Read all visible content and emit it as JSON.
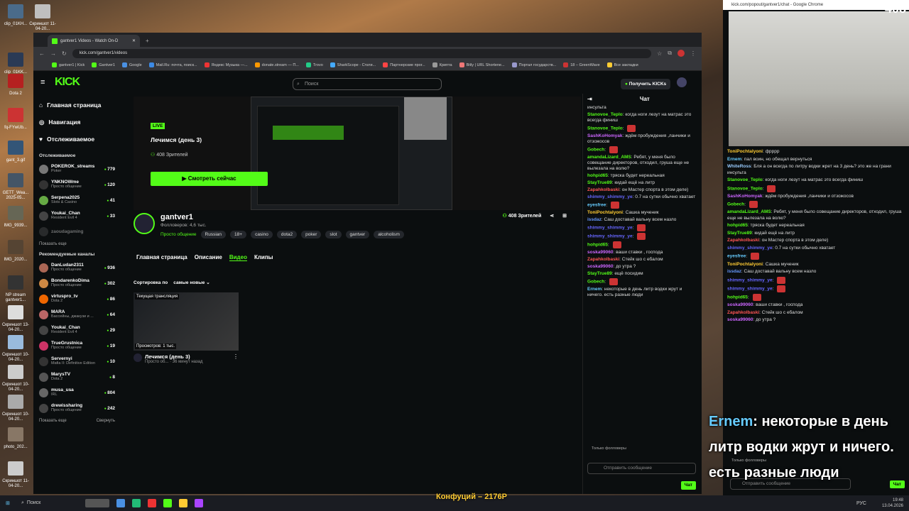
{
  "desktop": {
    "icons": [
      {
        "label": "clip_01KH...",
        "color": "#4a6b8a"
      },
      {
        "label": "Скриншот 11-04-20...",
        "color": "#bfbfbf"
      },
      {
        "label": "clip_01KK...",
        "color": "#2a3a55"
      },
      {
        "label": "Dota 2",
        "color": "#b52020"
      },
      {
        "label": "fq-FYwUb...",
        "color": "#c33"
      },
      {
        "label": "gant_3.gif",
        "color": "#357"
      },
      {
        "label": "GETT_Wea... 2025-05...",
        "color": "#456"
      },
      {
        "label": "IMG_9939...",
        "color": "#665"
      },
      {
        "label": "IMG_2020...",
        "color": "#543"
      },
      {
        "label": "NP stream gantver1...",
        "color": "#333"
      },
      {
        "label": "Скриншот 13-04-20...",
        "color": "#ddd"
      },
      {
        "label": "Скриншот 10-04-20...",
        "color": "#9bd"
      },
      {
        "label": "Скриншот 10-04-20...",
        "color": "#ccc"
      },
      {
        "label": "Скриншот 10-04-20...",
        "color": "#aaa"
      },
      {
        "label": "photo_202...",
        "color": "#876"
      },
      {
        "label": "Скриншот 11-04-20...",
        "color": "#ccc"
      }
    ]
  },
  "browser": {
    "tab_title": "gantver1 Videos - Watch On-D",
    "url": "kick.com/gantver1/videos",
    "bookmarks": [
      "gantver1 | Kick",
      "Gantver1",
      "Google",
      "Mail.Ru: почта, поиск...",
      "Яндекс Музыка —...",
      "donate.stream — П...",
      "Trovo",
      "SharkScope - Стати...",
      "Партнерские прог...",
      "Криптa",
      "Bitly | URL Shortene...",
      "Портал государств...",
      "18 – GreenWave",
      "Все закладки"
    ]
  },
  "kick": {
    "logo": "KICK",
    "search_placeholder": "Поиск",
    "get_kicks": "Получить KICKs",
    "nav": [
      {
        "label": "Главная страница",
        "icon": "home-icon"
      },
      {
        "label": "Навигация",
        "icon": "compass-icon"
      },
      {
        "label": "Отслеживаемое",
        "icon": "heart-icon"
      }
    ],
    "following_title": "Отслеживаемое",
    "following": [
      {
        "name": "POKEROK_streams",
        "cat": "Poker",
        "viewers": "779",
        "color": "#777"
      },
      {
        "name": "YNKNOWme",
        "cat": "Просто общение",
        "viewers": "120",
        "color": "#333"
      },
      {
        "name": "Serpena2025",
        "cat": "Slots & Casino",
        "viewers": "41",
        "color": "#6a4"
      },
      {
        "name": "Youkai_Chan",
        "cat": "Resident Evil 4",
        "viewers": "33",
        "color": "#444"
      },
      {
        "name": "zaoudagaming",
        "cat": "",
        "viewers": "",
        "color": "#555"
      }
    ],
    "show_more": "Показать еще",
    "recommended_title": "Рекомендуемые каналы",
    "recommended": [
      {
        "name": "DanLudan2311",
        "cat": "Просто общение",
        "viewers": "936",
        "color": "#a65"
      },
      {
        "name": "BondarenkoDima",
        "cat": "Просто общение",
        "viewers": "302",
        "color": "#c84"
      },
      {
        "name": "virtuspro_tv",
        "cat": "Dota 2",
        "viewers": "86",
        "color": "#e60"
      },
      {
        "name": "MARA",
        "cat": "Бассейны, джакузи и ...",
        "viewers": "64",
        "color": "#b66"
      },
      {
        "name": "Youkai_Chan",
        "cat": "Resident Evil 4",
        "viewers": "29",
        "color": "#444"
      },
      {
        "name": "TrueGrustnica",
        "cat": "Просто общение",
        "viewers": "19",
        "color": "#c36"
      },
      {
        "name": "Servernyi",
        "cat": "Mafia II: Definitive Edition",
        "viewers": "10",
        "color": "#333"
      },
      {
        "name": "MarysTV",
        "cat": "Dota 2",
        "viewers": "8",
        "color": "#555"
      },
      {
        "name": "musa_usa",
        "cat": "IRL",
        "viewers": "804",
        "color": "#666"
      },
      {
        "name": "drewissharing",
        "cat": "Просто общение",
        "viewers": "242",
        "color": "#444"
      }
    ],
    "show_more2": "Показать еще",
    "collapse": "Свернуть",
    "live_label": "LIVE",
    "stream_title": "Лечимся (день 3)",
    "live_viewers": "408 Зрителей",
    "watch_now": "Смотреть сейчас",
    "channel": {
      "name": "gantver1",
      "followers": "Фолловеров: 4,6 тыс.",
      "category": "Просто общение",
      "tags": [
        "Russian",
        "18+",
        "casino",
        "dota2",
        "poker",
        "slot",
        "gantver",
        "alcoholism"
      ],
      "viewers": "408 Зрителей"
    },
    "subnav": [
      "Главная страница",
      "Описание",
      "Видео",
      "Клипы"
    ],
    "sort_label": "Сортировка по",
    "sort_value": "самые новые",
    "video": {
      "badge": "Текущая трансляция",
      "views": "Просмотров: 1 тыс.",
      "title": "Лечимся (день 3)",
      "meta": "Просто об... · 36 минут назад"
    }
  },
  "chat": {
    "title": "Чат",
    "messages": [
      {
        "user": "",
        "text": "инсульта",
        "color": "#ddd"
      },
      {
        "user": "Stanovoe_Teplo",
        "text": "когда ноги лезут на матрас это всегда финиш",
        "color": "#53fc18"
      },
      {
        "user": "Stanovoe_Teplo",
        "text": "",
        "color": "#53fc18"
      },
      {
        "user": "SashKoHomyak",
        "text": "ждём пробуждения ,ланчики и отзожосов",
        "color": "#c6f"
      },
      {
        "user": "Gobech",
        "text": "",
        "color": "#53fc18"
      },
      {
        "user": "amandaLizard_AMS",
        "text": "Ребят, у меня было совещание директоров, отходил, груша еще не вылезала на волю?",
        "color": "#53fc18"
      },
      {
        "user": "hohpid65",
        "text": "тряска будет нереальная",
        "color": "#53fc18"
      },
      {
        "user": "StayTrue89",
        "text": "кидай ещё на литр",
        "color": "#53fc18"
      },
      {
        "user": "Zapahkolbaski",
        "text": "он Мастер спорта в этом деле)",
        "color": "#f55"
      },
      {
        "user": "shimmy_shimmy_ye",
        "text": "0.7 на сутки обычно хватает",
        "color": "#66f"
      },
      {
        "user": "eyesfree",
        "text": "",
        "color": "#6cf"
      },
      {
        "user": "ToniPochtalyoni",
        "text": "Сашка мученик",
        "color": "#fc3"
      },
      {
        "user": "issdaz",
        "text": "Саш доставай вальну всем назло",
        "color": "#69f"
      },
      {
        "user": "shimmy_shimmy_ye",
        "text": "",
        "color": "#66f"
      },
      {
        "user": "shimmy_shimmy_ye",
        "text": "",
        "color": "#66f"
      },
      {
        "user": "hohpid65",
        "text": "",
        "color": "#53fc18"
      },
      {
        "user": "soska99060",
        "text": "ваши ставки , господа",
        "color": "#c6f"
      },
      {
        "user": "Zapahkolbaski",
        "text": "Стейк шо с ебалом",
        "color": "#f55"
      },
      {
        "user": "soska99060",
        "text": "до утра ?",
        "color": "#c6f"
      },
      {
        "user": "StayTrue89",
        "text": "ещё посидим",
        "color": "#53fc18"
      },
      {
        "user": "Gobech",
        "text": "",
        "color": "#53fc18"
      },
      {
        "user": "Ernem",
        "text": "некоторые в день литр водки жрут и ничего. есть разные люди",
        "color": "#6cf"
      }
    ],
    "followers_only": "Только фолловеры",
    "input_placeholder": "Отправить сообщение",
    "send": "Чат"
  },
  "popout": {
    "title": "kick.com/popout/gantver1/chat - Google Chrome",
    "viewers": "408",
    "messages": [
      {
        "user": "ToniPochtalyoni",
        "text": "фрррр",
        "color": "#fc3"
      },
      {
        "user": "Ernem",
        "text": "пал воин, но обещал вернуться",
        "color": "#6cf"
      },
      {
        "user": "WhiteRoss",
        "text": "Бля а он всегда по литру водки жрет на 3 день? это же на грани инсульта",
        "color": "#9cf"
      },
      {
        "user": "Stanovoe_Teplo",
        "text": "когда ноги лезут на матрас это всегда финиш",
        "color": "#53fc18"
      },
      {
        "user": "Stanovoe_Teplo",
        "text": "",
        "color": "#53fc18"
      },
      {
        "user": "SashKoHomyak",
        "text": "ждём пробуждения ,ланчики и отзожосов",
        "color": "#c6f"
      },
      {
        "user": "Gobech",
        "text": "",
        "color": "#53fc18"
      },
      {
        "user": "amandaLizard_AMS",
        "text": "Ребят, у меня было совещание директоров, отходил, груша еще не вылезала на волю?",
        "color": "#53fc18"
      },
      {
        "user": "hohpid65",
        "text": "тряска будет нереальная",
        "color": "#53fc18"
      },
      {
        "user": "StayTrue89",
        "text": "кидай ещё на литр",
        "color": "#53fc18"
      },
      {
        "user": "Zapahkolbaski",
        "text": "он Мастер спорта в этом деле)",
        "color": "#f55"
      },
      {
        "user": "shimmy_shimmy_ye",
        "text": "0.7 на сутки обычно хватает",
        "color": "#66f"
      },
      {
        "user": "eyesfree",
        "text": "",
        "color": "#6cf"
      },
      {
        "user": "ToniPochtalyoni",
        "text": "Сашка мученик",
        "color": "#fc3"
      },
      {
        "user": "issdaz",
        "text": "Саш доставай вальну всем назло",
        "color": "#69f"
      },
      {
        "user": "shimmy_shimmy_ye",
        "text": "",
        "color": "#66f"
      },
      {
        "user": "shimmy_shimmy_ye",
        "text": "",
        "color": "#66f"
      },
      {
        "user": "hohpid65",
        "text": "",
        "color": "#53fc18"
      },
      {
        "user": "soska99060",
        "text": "ваши ставки , господа",
        "color": "#c6f"
      },
      {
        "user": "Zapahkolbaski",
        "text": "Стейк шо с ебалом",
        "color": "#f55"
      },
      {
        "user": "soska99060",
        "text": "до утра ?",
        "color": "#c6f"
      }
    ],
    "overlay_user": "Ernem",
    "overlay_text": ": некоторые в день литр водки жрут и ничего. есть разные люди",
    "followers_only": "Только фолловеры",
    "input_placeholder": "Отправить сообщение",
    "send": "Чат"
  },
  "taskbar": {
    "search": "Поиск",
    "donation": "Конфуций – 2176Р",
    "time": "19:48",
    "date": "13.04.2026",
    "lang": "РУС"
  }
}
